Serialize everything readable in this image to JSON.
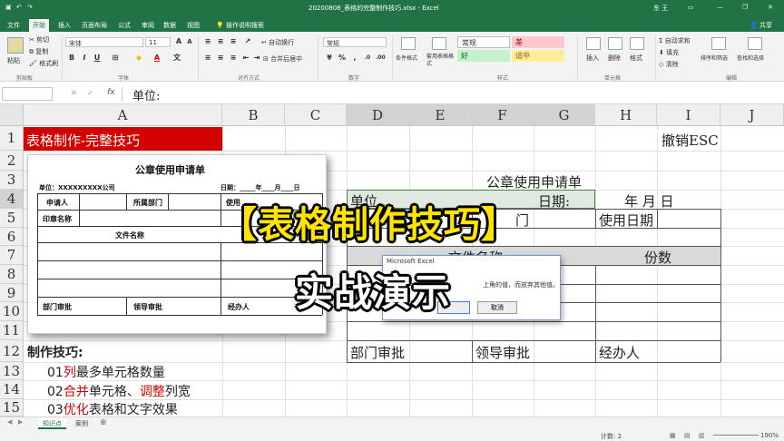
{
  "titlebar": {
    "doc_title": "20200808_表格的完整制作技巧.xlsx - Excel",
    "user": "东 王"
  },
  "tabs": [
    "文件",
    "开始",
    "插入",
    "页面布局",
    "公式",
    "审阅",
    "数据",
    "视图"
  ],
  "tell_me": "操作说明搜索",
  "share": "共享",
  "ribbon": {
    "paste": "粘贴",
    "cut": "剪切",
    "copy": "复制",
    "format_painter": "格式刷",
    "clipboard": "剪贴板",
    "font_name": "宋体",
    "font_size": "11",
    "font_group": "字体",
    "bold": "B",
    "italic": "I",
    "underline": "U",
    "wrap": "自动换行",
    "merge": "合并后居中",
    "align_group": "对齐方式",
    "number_format": "常规",
    "number_group": "数字",
    "cond_format": "条件格式",
    "table_format": "套用表格格式",
    "style_normal": "常规",
    "style_bad": "差",
    "style_good": "好",
    "style_neutral": "适中",
    "styles_group": "样式",
    "insert": "插入",
    "delete": "删除",
    "format": "格式",
    "cells_group": "单元格",
    "autosum": "自动求和",
    "fill": "填充",
    "clear": "清除",
    "sort_filter": "排序和筛选",
    "find_select": "查找和选择",
    "editing_group": "编辑"
  },
  "formula": {
    "fx": "fx",
    "value": "单位:"
  },
  "columns": [
    "A",
    "B",
    "C",
    "D",
    "E",
    "F",
    "G",
    "H",
    "I",
    "J"
  ],
  "rows": [
    "1",
    "2",
    "3",
    "4",
    "5",
    "6",
    "7",
    "8",
    "9",
    "10",
    "11",
    "12",
    "13",
    "14",
    "15"
  ],
  "cells": {
    "a1": "表格制作-完整技巧",
    "i1": "撤销ESC",
    "title": "公章使用申请单",
    "d4": "单位",
    "g4": "日期:",
    "h4": "年    月    日",
    "f5": "门",
    "h5": "使用日期",
    "f7": "文件名称",
    "h7": "份数",
    "d12": "部门审批",
    "f12": "领导审批",
    "h12": "经办人",
    "a12": "制作技巧:",
    "tip1_num": "01",
    "tip1_red": "列",
    "tip1_rest": "最多单元格数量",
    "tip2_num": "02",
    "tip2_red": "合并",
    "tip2_mid": "单元格、",
    "tip2_red2": "调整",
    "tip2_rest": "列宽",
    "tip3_num": "03",
    "tip3_red": "优化",
    "tip3_rest": "表格和文字效果"
  },
  "form": {
    "title": "公章使用申请单",
    "unit": "单位：XXXXXXXXX公司",
    "date": "日期：_____年____月____日",
    "applicant": "申请人",
    "dept": "所属部门",
    "use": "使用",
    "seal_name": "印章名称",
    "file_name": "文件名称",
    "dept_approve": "部门审批",
    "leader_approve": "领导审批",
    "handler": "经办人"
  },
  "dialog": {
    "title": "Microsoft Excel",
    "message": "上角的值，而放弃其他值。",
    "cancel": "取消"
  },
  "banner": {
    "line1": "【表格制作技巧】",
    "line2": "实战演示"
  },
  "status": {
    "sheet1": "知识点",
    "sheet2": "案例",
    "count": "计数: 2",
    "zoom": "190%"
  },
  "colors": {
    "excel_green": "#217346",
    "title_red": "#d40000",
    "banner_yellow": "#ffe400"
  }
}
